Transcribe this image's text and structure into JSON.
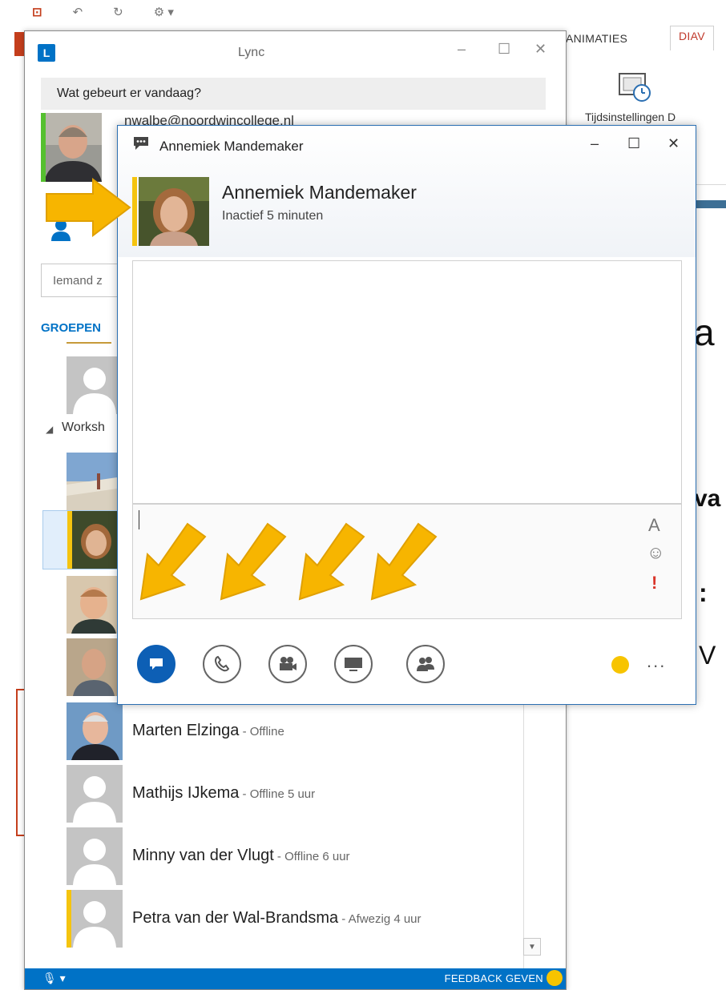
{
  "ppt": {
    "tab_animaties": "ANIMATIES",
    "tab_diav": "DIAV",
    "timing_label": "Tijdsinstellingen D",
    "slide_fragments": [
      "a",
      "va",
      ":",
      "V"
    ]
  },
  "lync": {
    "title": "Lync",
    "status_prompt": "Wat gebeurt er vandaag?",
    "email_partial": "nwalbe@noordwincollege.nl",
    "search_placeholder": "Iemand z",
    "tab_groups": "GROEPEN",
    "group_header": "Worksh",
    "footer_feedback": "FEEDBACK GEVEN",
    "contacts": [
      {
        "name": "Marten Elzinga",
        "status": " - Offline",
        "presence_color": "none"
      },
      {
        "name": "Mathijs IJkema",
        "status": " - Offline 5 uur",
        "presence_color": "none"
      },
      {
        "name": "Minny van der Vlugt",
        "status": " - Offline 6 uur",
        "presence_color": "none"
      },
      {
        "name": "Petra van der Wal-Brandsma",
        "status": " - Afwezig 4 uur",
        "presence_color": "#f5c40f"
      }
    ]
  },
  "conversation": {
    "window_title": "Annemiek Mandemaker",
    "contact_name": "Annemiek Mandemaker",
    "contact_status": "Inactief 5 minuten",
    "font_tool": "A",
    "emoticon_tool": "☺",
    "priority_tool": "!",
    "more_label": "..."
  },
  "colors": {
    "accent_blue": "#0072c6",
    "presence_away": "#f5c40f",
    "presence_available": "#55c02f",
    "annotation_arrow": "#f7b500"
  },
  "icons": [
    "chat-icon",
    "phone-icon",
    "video-icon",
    "present-icon",
    "participants-icon",
    "smiley-icon",
    "more-icon",
    "minimize-icon",
    "maximize-icon",
    "close-icon"
  ]
}
